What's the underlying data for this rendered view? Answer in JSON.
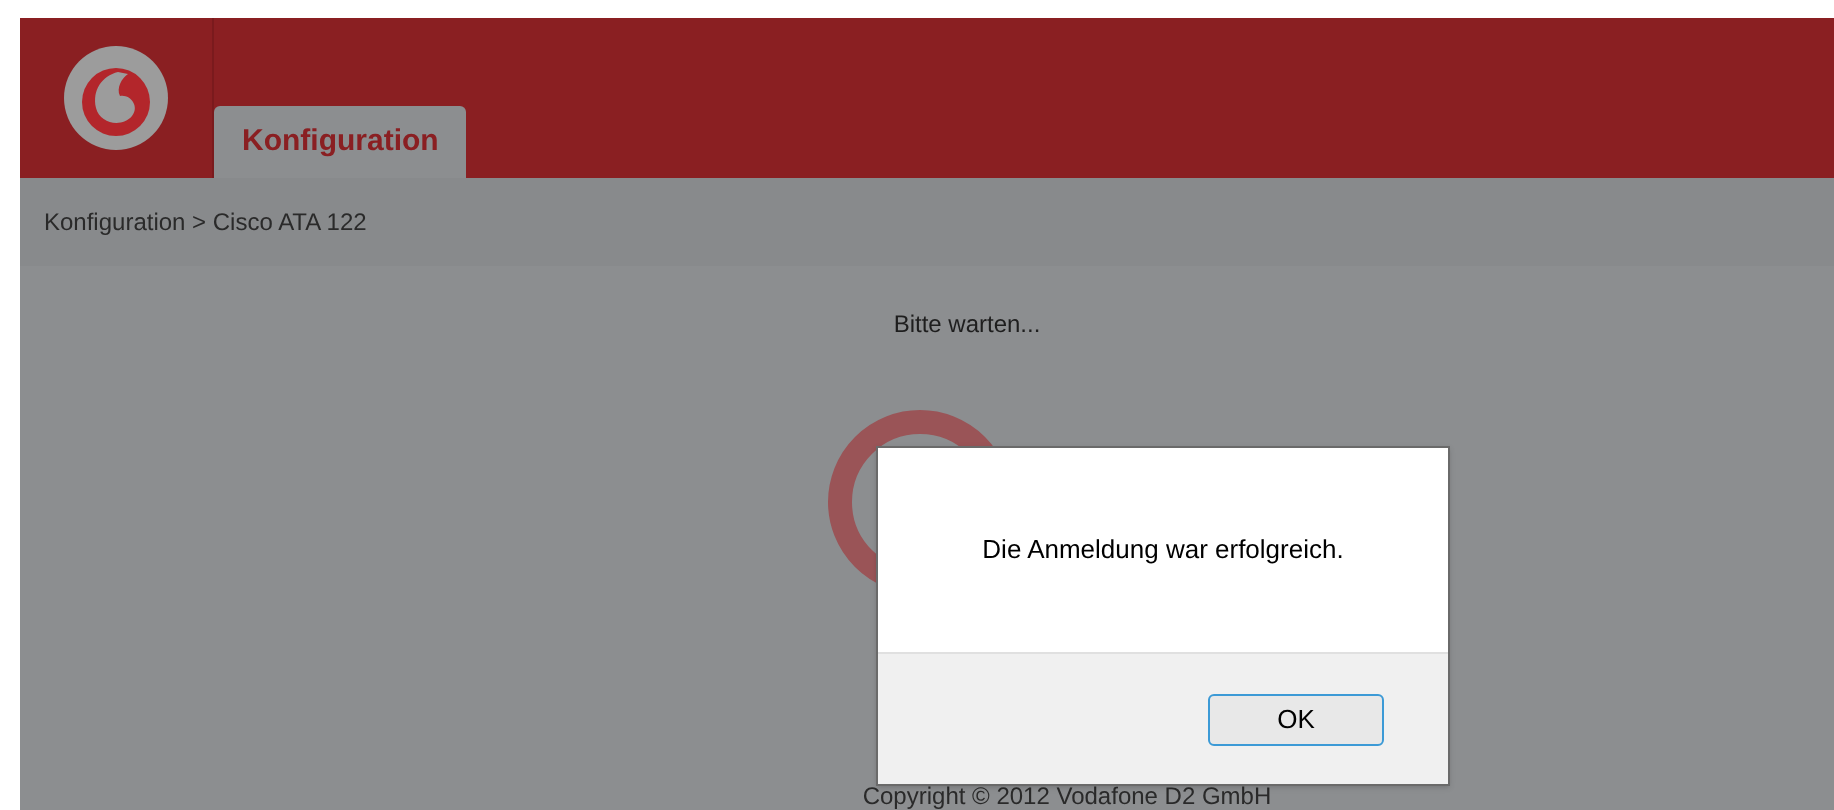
{
  "header": {
    "tabs": [
      {
        "label": "Konfiguration",
        "selected": true
      }
    ]
  },
  "breadcrumb": "Konfiguration > Cisco ATA 122",
  "content": {
    "status": "Bitte warten...",
    "footer": "Copyright © 2012 Vodafone D2 GmbH"
  },
  "dialog": {
    "message": "Die Anmeldung war erfolgreich.",
    "buttons": [
      "OK"
    ]
  }
}
